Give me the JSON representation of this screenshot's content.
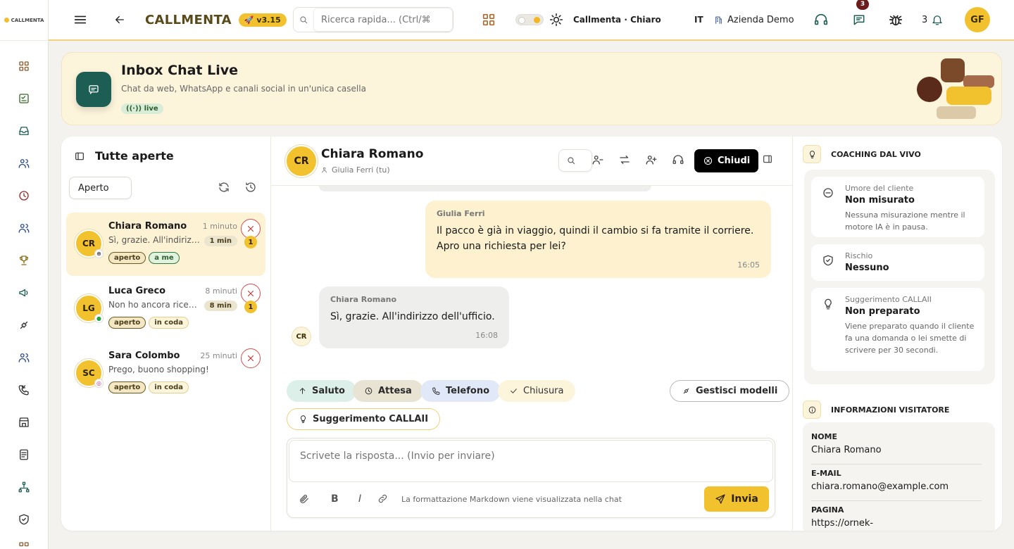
{
  "rail": {
    "brand": "CALLMENTA",
    "items": [
      "dashboard-icon",
      "tasks-icon",
      "inbox-icon",
      "users-icon",
      "clock-icon",
      "team-icon",
      "trophy-icon",
      "megaphone-icon",
      "integrations-icon",
      "contacts-icon",
      "calls-icon",
      "store-icon",
      "reports-icon",
      "org-chart-icon",
      "shield-icon",
      "apps-icon"
    ]
  },
  "topbar": {
    "app_name": "CALLMENTA",
    "version": "v3.15",
    "search_placeholder": "Ricerca rapida... (Ctrl/⌘",
    "theme_label": "Callmenta · Chiaro",
    "language": "IT",
    "company": "Azienda Demo",
    "chat_badge": "3",
    "notifications_count": "3",
    "user_initials": "GF"
  },
  "hero": {
    "title": "Inbox Chat Live",
    "subtitle": "Chat da web, WhatsApp e canali social in un'unica casella",
    "live_badge": "live"
  },
  "list": {
    "title": "Tutte aperte",
    "filter": "Aperto",
    "conversations": [
      {
        "initials": "CR",
        "name": "Chiara Romano",
        "time": "1 minuto",
        "preview": "Sì, grazie. All'indirizzo dell'ufficio.",
        "wait": "1 min",
        "unread": "1",
        "tag1": "aperto",
        "tag2": "a me",
        "channel": "web"
      },
      {
        "initials": "LG",
        "name": "Luca Greco",
        "time": "8 minuti",
        "preview": "Non ho ancora ricevuto il pacco",
        "wait": "8 min",
        "unread": "1",
        "tag1": "aperto",
        "tag2": "in coda",
        "channel": "whatsapp"
      },
      {
        "initials": "SC",
        "name": "Sara Colombo",
        "time": "25 minuti",
        "preview": "Prego, buono shopping!",
        "tag1": "aperto",
        "tag2": "in coda",
        "channel": "instagram"
      }
    ]
  },
  "chat": {
    "initials": "CR",
    "name": "Chiara Romano",
    "agent": "Giulia Ferri (tu)",
    "close_label": "Chiudi",
    "messages": [
      {
        "sender": "Giulia Ferri",
        "text": "Il pacco è già in viaggio, quindi il cambio si fa tramite il corriere. Apro una richiesta per lei?",
        "time": "16:05"
      },
      {
        "sender": "Chiara Romano",
        "text": "Sì, grazie. All'indirizzo dell'ufficio.",
        "time": "16:08",
        "initials": "CR"
      }
    ],
    "quick_replies": [
      "Saluto",
      "Attesa",
      "Telefono",
      "Chiusura"
    ],
    "manage_templates": "Gestisci modelli",
    "ai_suggestion": "Suggerimento CALLAII",
    "composer_placeholder": "Scrivete la risposta... (Invio per inviare)",
    "markdown_hint": "La formattazione Markdown viene visualizzata nella chat",
    "send_label": "Invia"
  },
  "side": {
    "coaching_title": "COACHING DAL VIVO",
    "coaching": [
      {
        "label": "Umore del cliente",
        "value": "Non misurato",
        "desc": "Nessuna misurazione mentre il motore IA è in pausa."
      },
      {
        "label": "Rischio",
        "value": "Nessuno",
        "desc": ""
      },
      {
        "label": "Suggerimento CALLAII",
        "value": "Non preparato",
        "desc": "Viene preparato quando il cliente fa una domanda o lei smette di scrivere per 30 secondi."
      }
    ],
    "visitor_title": "INFORMAZIONI VISITATORE",
    "visitor": [
      {
        "label": "NOME",
        "value": "Chiara Romano"
      },
      {
        "label": "E-MAIL",
        "value": "chiara.romano@example.com"
      },
      {
        "label": "PAGINA",
        "value": "https://ornek-"
      }
    ]
  },
  "colors": {
    "accent": "#f2c22e",
    "brand_dark": "#1d5e54",
    "danger": "#d35050"
  }
}
